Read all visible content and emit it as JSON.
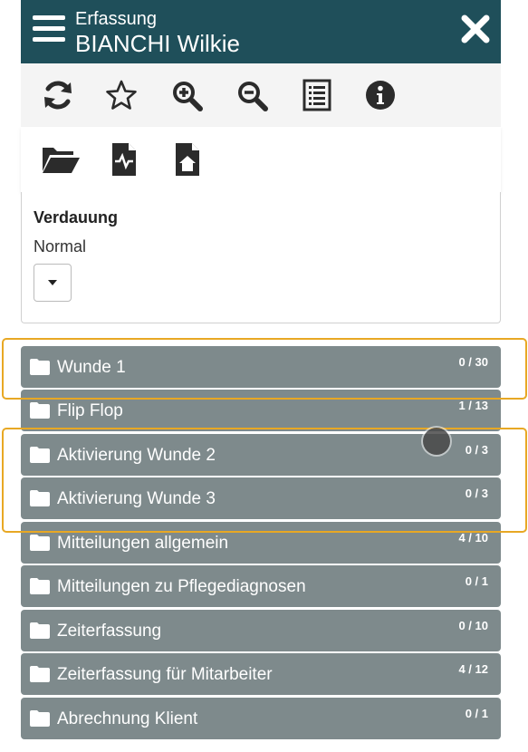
{
  "header": {
    "title": "Erfassung",
    "patient_name": "BIANCHI Wilkie",
    "menu_icon": "hamburger-menu-icon",
    "close_icon": "close-icon",
    "bg_color": "#1f4f5a"
  },
  "toolbar_row1": [
    {
      "icon": "refresh-icon"
    },
    {
      "icon": "star-icon"
    },
    {
      "icon": "zoom-in-icon"
    },
    {
      "icon": "zoom-out-icon"
    },
    {
      "icon": "list-icon"
    },
    {
      "icon": "info-icon"
    }
  ],
  "toolbar_row2": [
    {
      "icon": "folder-open-icon"
    },
    {
      "icon": "file-medical-icon"
    },
    {
      "icon": "file-home-icon"
    }
  ],
  "card": {
    "label": "Verdauung",
    "value": "Normal"
  },
  "folders": [
    {
      "label": "Wunde 1",
      "count": "0 / 30"
    },
    {
      "label": "Flip Flop",
      "count": "1 / 13"
    },
    {
      "label": "Aktivierung Wunde 2",
      "count": "0 / 3"
    },
    {
      "label": "Aktivierung Wunde 3",
      "count": "0 / 3"
    },
    {
      "label": "Mitteilungen allgemein",
      "count": "4 / 10"
    },
    {
      "label": "Mitteilungen zu Pflegediagnosen",
      "count": "0 / 1"
    },
    {
      "label": "Zeiterfassung",
      "count": "0 / 10"
    },
    {
      "label": "Zeiterfassung für Mitarbeiter",
      "count": "4 / 12"
    },
    {
      "label": "Abrechnung Klient",
      "count": "0 / 1"
    }
  ],
  "colors": {
    "folder_bg": "#7e8a8c",
    "highlight": "#e8a824"
  }
}
